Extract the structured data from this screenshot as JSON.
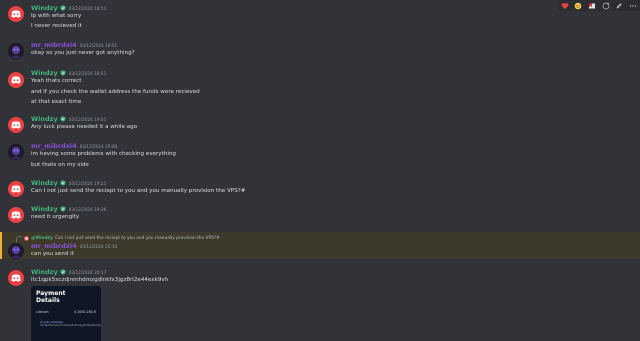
{
  "users": {
    "windzy": "Windzy",
    "mr": "mr_mibrdxi4"
  },
  "messages": [
    {
      "user": "windzy",
      "timestamp": "03/12/2024 18:51",
      "lines": [
        "Ip with what sorry",
        "I never recieved it"
      ]
    },
    {
      "user": "mr",
      "timestamp": "03/12/2024 18:51",
      "lines": [
        "okay so you just never got anything?"
      ]
    },
    {
      "user": "windzy",
      "timestamp": "03/12/2024 18:51",
      "lines": [
        "Yeah thats correct",
        "and if you check the wallet address the funds were recieved",
        "at that exact time"
      ]
    },
    {
      "user": "windzy",
      "timestamp": "03/12/2024 19:01",
      "lines": [
        "Any luck please needed it a while ago"
      ]
    },
    {
      "user": "mr",
      "timestamp": "03/12/2024 19:08",
      "lines": [
        "im having some problems with checking everything",
        "but thats on my side"
      ]
    },
    {
      "user": "windzy",
      "timestamp": "03/12/2024 19:21",
      "lines": [
        "Can I not just send the reciept to you and you manually provision the VPS?#"
      ]
    },
    {
      "user": "windzy",
      "timestamp": "03/12/2024 19:36",
      "lines": [
        "need it urgenglty"
      ]
    },
    {
      "user": "mr",
      "timestamp": "03/12/2024 20:16",
      "lines": [
        "can you send it"
      ]
    },
    {
      "user": "windzy",
      "timestamp": "03/12/2024 20:17",
      "lines": [
        "ltc1qpk5xczdjnmhdmzgdlnkfx3jgz8rl2e44exk9vh"
      ]
    }
  ],
  "reply": {
    "mention": "@Windzy",
    "quoted": "Can I not just send the reciept to you and you manually provision the VPS?#"
  },
  "payment_card": {
    "title": "Payment Details",
    "coin": "Litecoin",
    "amount": "0.2000-280-R",
    "address_label": "Crypto Address",
    "address": "ltc1qpk5xczdjnmhdmzgdlnkfx3jgz8rl2e44exk9vh"
  },
  "colors": {
    "background": "#313338",
    "windzy_name": "#43b581",
    "mr_name": "#8a4fd8",
    "reply_highlight": "#3d3a2c",
    "reply_bar": "#f0b232",
    "discord_blurple_red": "#ed4245"
  },
  "icons": [
    "discord-logo-icon",
    "verified-badge-icon",
    "reply-arrow-icon",
    "reaction-emoji-icon",
    "add-reaction-icon",
    "edit-icon",
    "more-options-icon"
  ]
}
